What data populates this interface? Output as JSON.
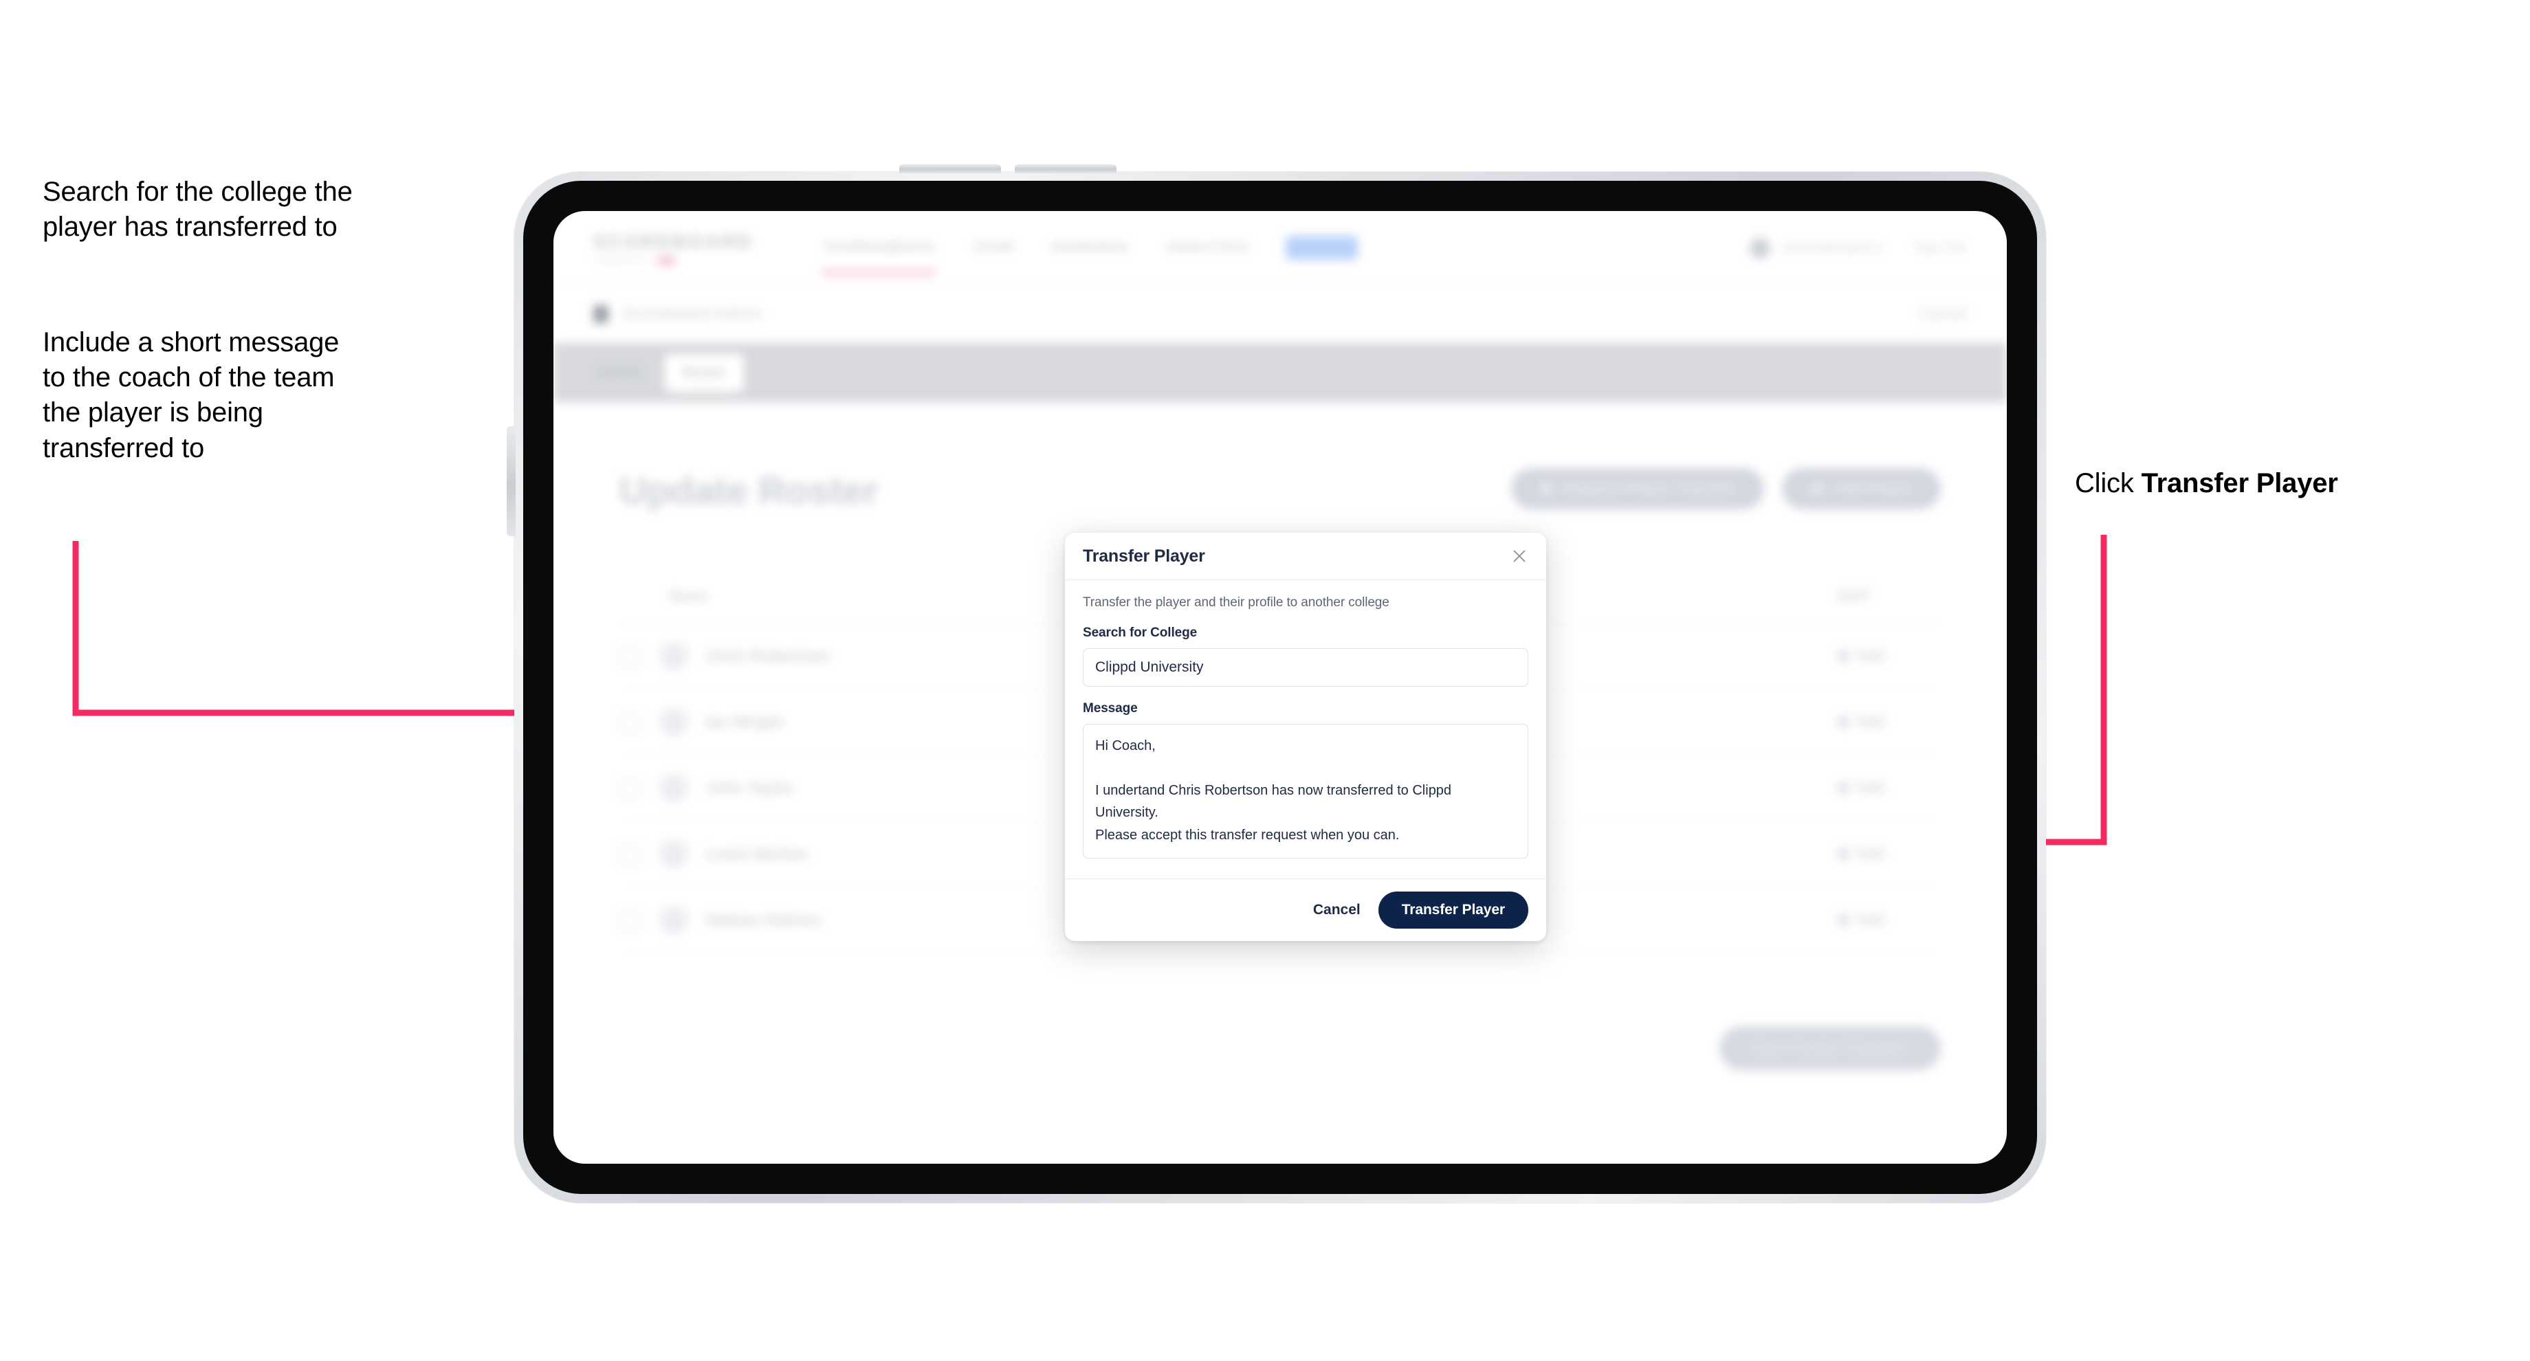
{
  "annotations": {
    "left_top": "Search for the college the\nplayer has transferred to",
    "left_bottom": "Include a short message\nto the coach of the team\nthe player is being\ntransferred to",
    "right_prefix": "Click ",
    "right_bold": "Transfer Player"
  },
  "colors": {
    "arrow_pink": "#F42B60",
    "primary_navy": "#0D2349",
    "modal_text": "#1F2A44"
  },
  "app": {
    "brand": {
      "word": "SCOREBOARD",
      "sub": "POWERED BY",
      "dot_label": ""
    },
    "nav": [
      {
        "label": "TOURNAMENTS"
      },
      {
        "label": "TEAM"
      },
      {
        "label": "RANKINGS"
      },
      {
        "label": "ANALYTICS"
      },
      {
        "label": "ADMIN"
      }
    ],
    "header_user": "admin@clippd.io",
    "header_signout": "Sign Out",
    "breadcrumb": "Scoreboard Admin",
    "breadcrumb_action": "Cancel",
    "tabs": [
      {
        "label": "Details",
        "active": false
      },
      {
        "label": "Roster",
        "active": true
      }
    ],
    "page_title": "Update Roster",
    "top_actions": [
      {
        "label": "Request Player Transfer"
      },
      {
        "label": "Add Player"
      }
    ],
    "roster": {
      "columns": {
        "name": "Name",
        "action": "EDIT"
      },
      "rows": [
        {
          "name": "Chris Robertson",
          "action": "Edit"
        },
        {
          "name": "Ian Wright",
          "action": "Edit"
        },
        {
          "name": "John Taylor",
          "action": "Edit"
        },
        {
          "name": "Lewis Barlow",
          "action": "Edit"
        },
        {
          "name": "Nathan Holmes",
          "action": "Edit"
        }
      ]
    },
    "bottom_cta": "Save Roster Changes"
  },
  "modal": {
    "title": "Transfer Player",
    "close_icon": "close-icon",
    "description": "Transfer the player and their profile to another college",
    "college_field": {
      "label": "Search for College",
      "value": "Clippd University",
      "placeholder": "Search for College"
    },
    "message_field": {
      "label": "Message",
      "value": "Hi Coach,\n\nI undertand Chris Robertson has now transferred to Clippd University.\nPlease accept this transfer request when you can.",
      "placeholder": "Message"
    },
    "cancel_label": "Cancel",
    "submit_label": "Transfer Player"
  }
}
